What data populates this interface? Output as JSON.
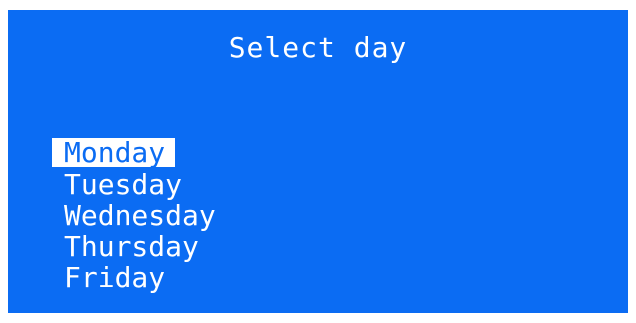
{
  "screen": {
    "title": "Select day",
    "background_color": "#0b6cf3",
    "text_color": "#ffffff",
    "highlight_color": "#ffffff"
  },
  "menu": {
    "selected_index": 0,
    "items": [
      {
        "label": "Monday"
      },
      {
        "label": "Tuesday"
      },
      {
        "label": "Wednesday"
      },
      {
        "label": "Thursday"
      },
      {
        "label": "Friday"
      }
    ]
  }
}
